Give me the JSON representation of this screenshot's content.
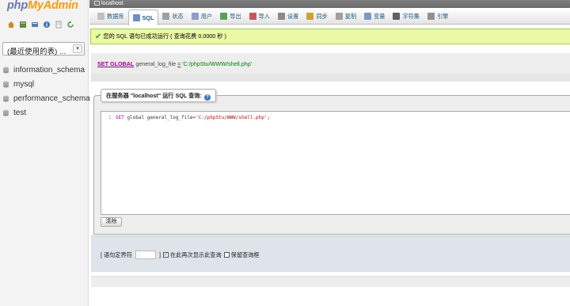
{
  "nav": {
    "logo": {
      "part1": "php",
      "part2": "My",
      "part3": "Admin"
    },
    "icons": [
      "home-icon",
      "database-icon",
      "settings-icon",
      "info-icon",
      "doc-icon",
      "reload-icon"
    ],
    "recent_label": "(最近使用的表) ...",
    "databases": [
      "information_schema",
      "mysql",
      "performance_schema",
      "test"
    ]
  },
  "server_bar": {
    "label": "localhost"
  },
  "tabs": [
    {
      "label": "数据库",
      "icon": "database-icon",
      "color": "#c0c0c0"
    },
    {
      "label": "SQL",
      "icon": "sql-icon",
      "color": "#6a8fc8"
    },
    {
      "label": "状态",
      "icon": "status-icon",
      "color": "#a0a0a0"
    },
    {
      "label": "用户",
      "icon": "users-icon",
      "color": "#8aa0c8"
    },
    {
      "label": "导出",
      "icon": "export-icon",
      "color": "#5aa05a"
    },
    {
      "label": "导入",
      "icon": "import-icon",
      "color": "#c05a5a"
    },
    {
      "label": "设置",
      "icon": "wrench-icon",
      "color": "#8a8a8a"
    },
    {
      "label": "同步",
      "icon": "sync-icon",
      "color": "#d0a030"
    },
    {
      "label": "复制",
      "icon": "replication-icon",
      "color": "#a0a0a0"
    },
    {
      "label": "变量",
      "icon": "variables-icon",
      "color": "#7a9ac8"
    },
    {
      "label": "字符集",
      "icon": "charset-icon",
      "color": "#606060"
    },
    {
      "label": "引擎",
      "icon": "engine-icon",
      "color": "#909090"
    }
  ],
  "message": {
    "text": "您的 SQL 语句已成功运行 ( 查询花费 0.0000 秒 )"
  },
  "executed_query": {
    "keyword": "SET GLOBAL",
    "variable": "general_log_file",
    "operator": "=",
    "value": "'C:/phpStu/WWW/shell.php'"
  },
  "sql_box": {
    "legend": "在服务器 \"localhost\" 运行 SQL 查询:",
    "line_number": "1",
    "code_keyword": "SET",
    "code_middle": " global general_log_file=",
    "code_string": "'C:/phpStu/WWW/shell.php'",
    "code_end": ";",
    "clear_label": "清除"
  },
  "options": {
    "delimiter_label": "[ 语句定界符",
    "delimiter_value": ";",
    "delimiter_close": "]",
    "show_again_label": "在此再次显示此查询",
    "show_again_checked": true,
    "retain_label": "保留查询框",
    "retain_checked": false
  }
}
